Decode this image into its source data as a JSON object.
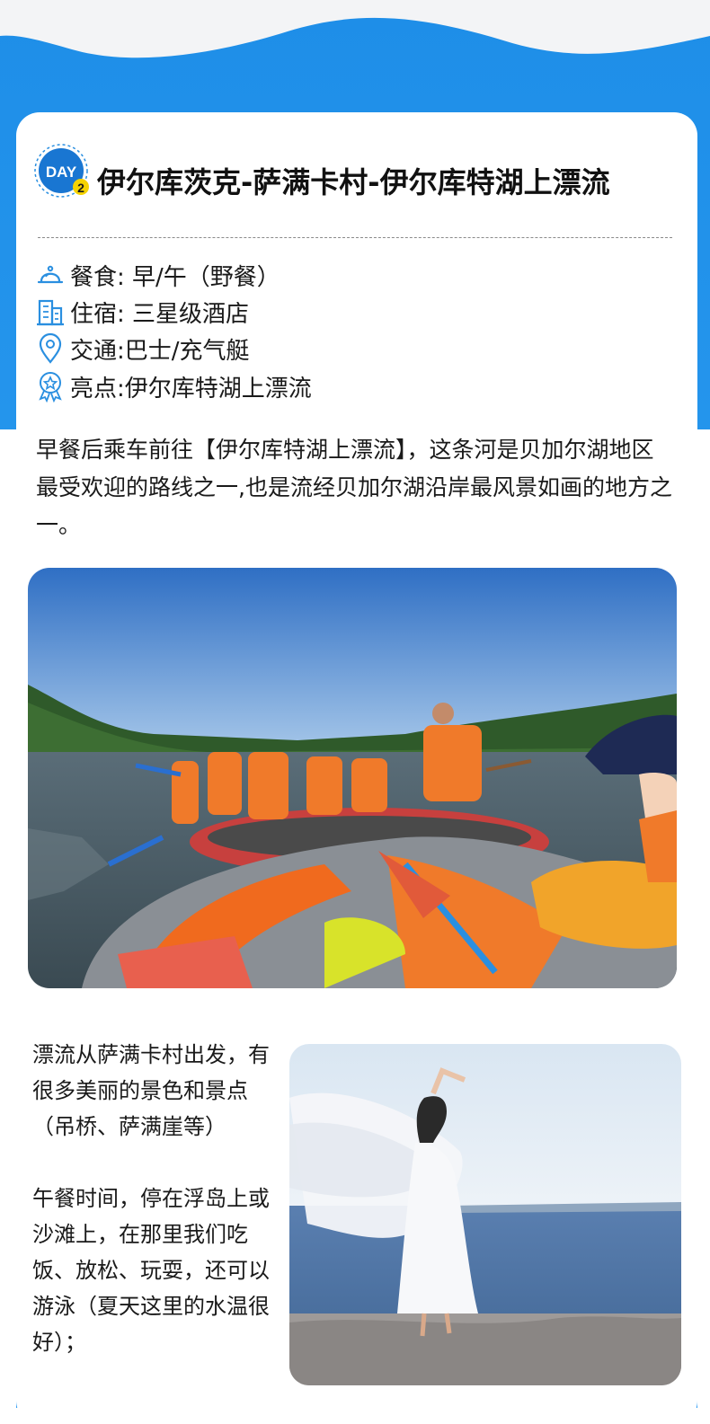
{
  "header": {
    "day_badge_label": "DAY",
    "day_number": "2",
    "title": "伊尔库茨克-萨满卡村-伊尔库特湖上漂流"
  },
  "info": {
    "meals": "餐食: 早/午（野餐）",
    "lodging": "住宿: 三星级酒店",
    "transport": "交通:巴士/充气艇",
    "highlight": "亮点:伊尔库特湖上漂流",
    "icons": [
      "meal-cloche-icon",
      "hotel-building-icon",
      "location-pin-icon",
      "star-badge-icon"
    ]
  },
  "intro": {
    "paragraph": "早餐后乘车前往【伊尔库特湖上漂流】，这条河是贝加尔湖地区最受欢迎的路线之一,也是流经贝加尔湖沿岸最风景如画的地方之一。"
  },
  "photos": {
    "raft_photo": "rafting-group-photo",
    "woman_photo": "woman-on-beach-photo"
  },
  "side": {
    "para1": "漂流从萨满卡村出发，有很多美丽的景色和景点（吊桥、萨满崖等）",
    "para2": "午餐时间，停在浮岛上或沙滩上，在那里我们吃饭、放松、玩耍，还可以游泳（夏天这里的水温很好）；"
  },
  "colors": {
    "accent_blue": "#2196f3",
    "icon_blue": "#2a8fe0",
    "badge_yellow": "#f5d300"
  }
}
